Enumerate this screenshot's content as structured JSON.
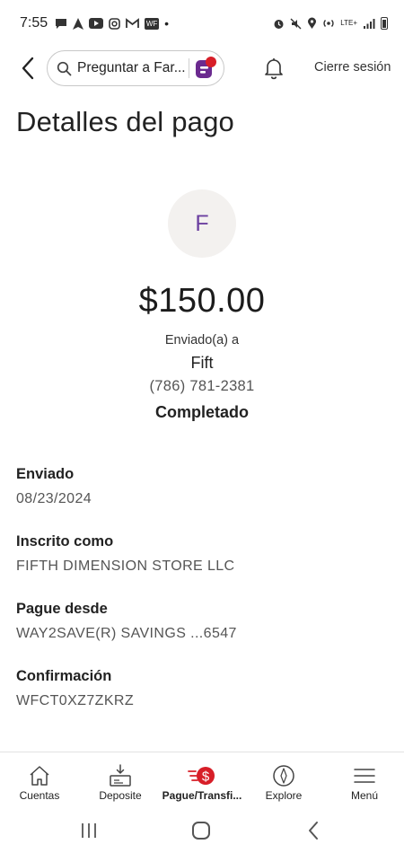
{
  "status_bar": {
    "time": "7:55",
    "left_icons": [
      "message-icon",
      "navigation-icon",
      "youtube-icon",
      "instagram-icon",
      "gmail-icon",
      "wf-icon",
      "dot-icon"
    ],
    "wf_badge": "WF",
    "lte": "LTE+",
    "right_icons": [
      "alarm-icon",
      "mute-icon",
      "location-icon",
      "hotspot-icon",
      "signal-icon",
      "battery-icon"
    ]
  },
  "header": {
    "search_text": "Preguntar a Far...",
    "signout_label": "Cierre sesión",
    "accent_color": "#d71e28",
    "fargo_color": "#6b2a8f"
  },
  "page_title": "Detalles del pago",
  "payment": {
    "avatar_letter": "F",
    "amount": "$150.00",
    "sent_to_label": "Enviado(a) a",
    "recipient": "Fift",
    "phone": "(786) 781-2381",
    "status": "Completado"
  },
  "details": [
    {
      "label": "Enviado",
      "value": "08/23/2024"
    },
    {
      "label": "Inscrito como",
      "value": "FIFTH DIMENSION STORE LLC"
    },
    {
      "label": "Pague desde",
      "value": "WAY2SAVE(R) SAVINGS ...6547"
    },
    {
      "label": "Confirmación",
      "value": "WFCT0XZ7ZKRZ"
    }
  ],
  "bottom_nav": {
    "items": [
      {
        "label": "Cuentas",
        "icon": "home-icon"
      },
      {
        "label": "Deposite",
        "icon": "deposit-icon"
      },
      {
        "label": "Pague/Transfi...",
        "icon": "pay-transfer-icon",
        "active": true
      },
      {
        "label": "Explore",
        "icon": "compass-icon"
      },
      {
        "label": "Menú",
        "icon": "menu-icon"
      }
    ]
  }
}
